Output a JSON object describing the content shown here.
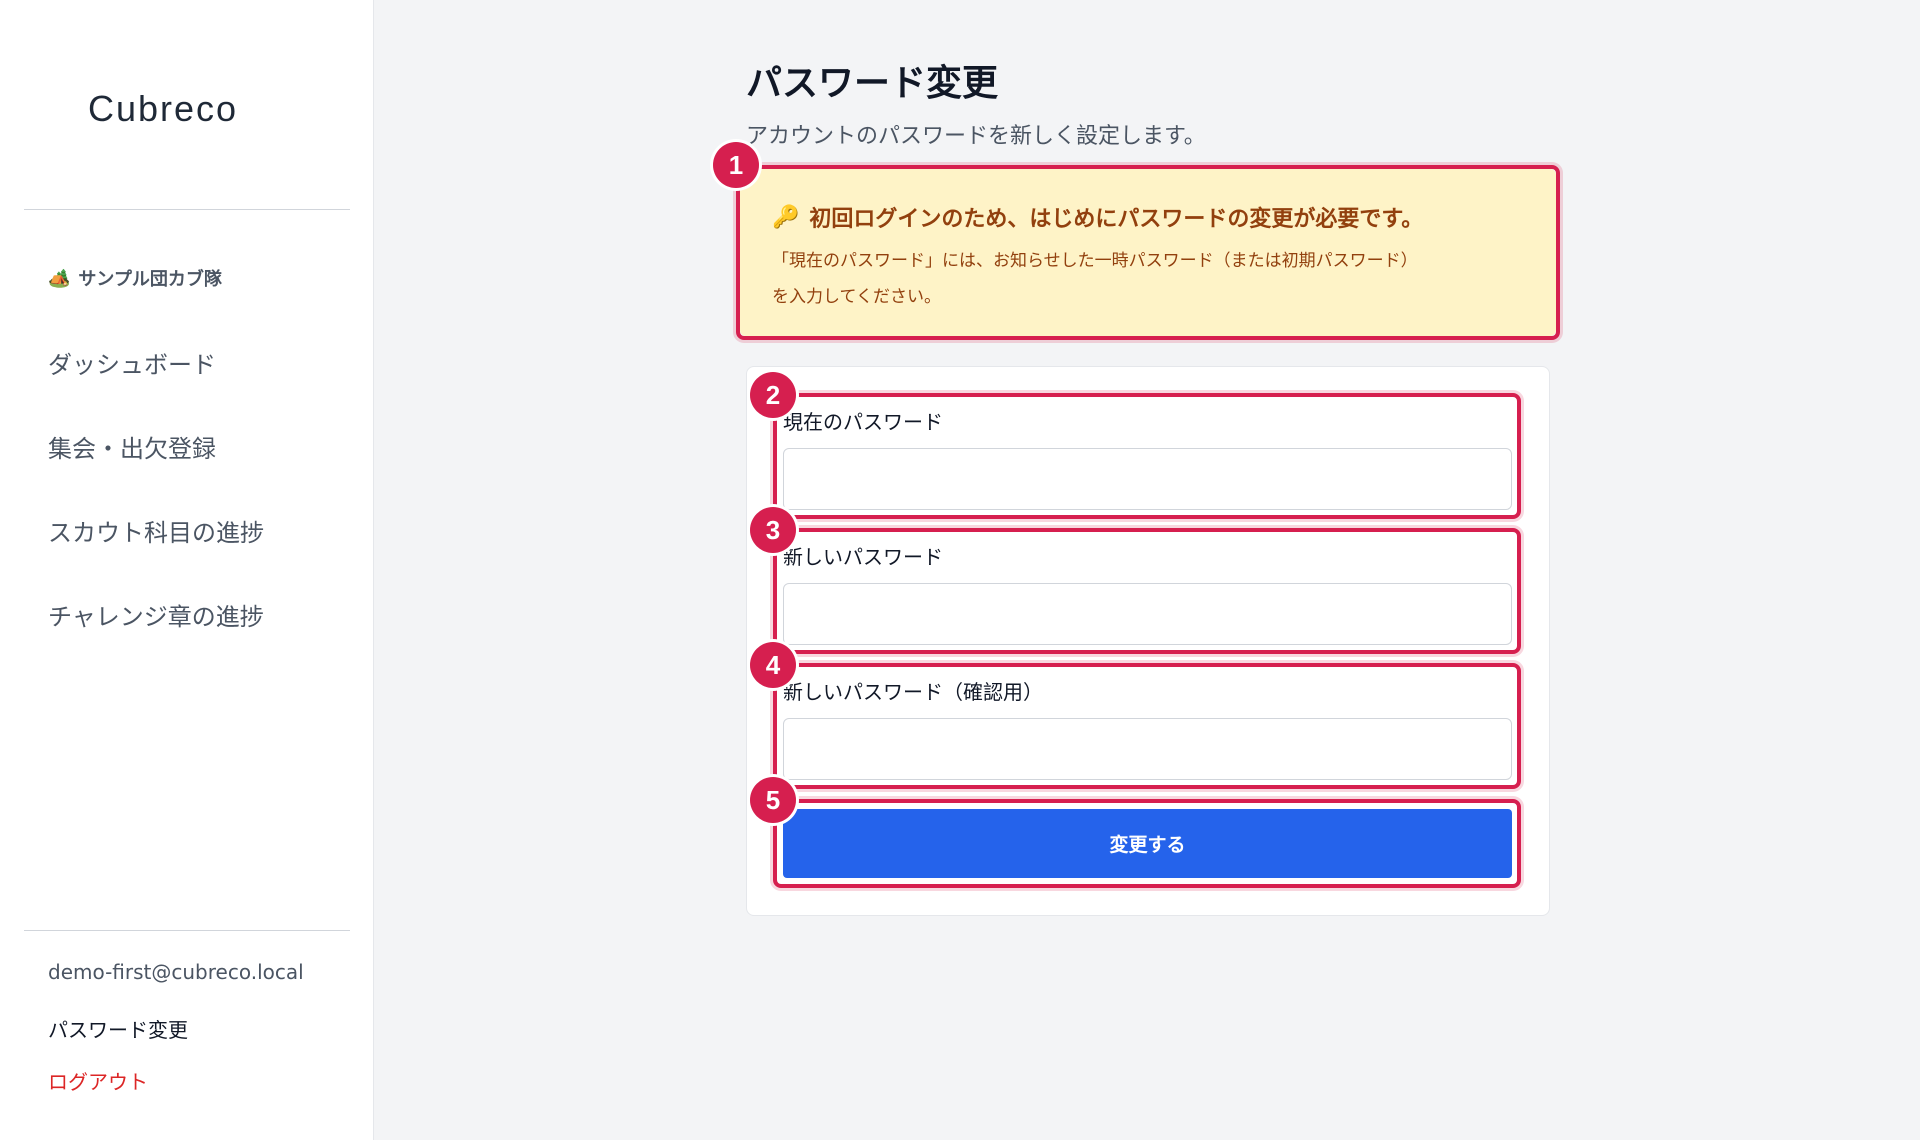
{
  "sidebar": {
    "logo": "Cubreco",
    "group": {
      "icon": "🏕️",
      "name": "サンプル団カブ隊"
    },
    "nav": [
      {
        "label": "ダッシュボード"
      },
      {
        "label": "集会・出欠登録"
      },
      {
        "label": "スカウト科目の進捗"
      },
      {
        "label": "チャレンジ章の進捗"
      }
    ],
    "user_email": "demo-first@cubreco.local",
    "password_link": "パスワード変更",
    "logout_link": "ログアウト"
  },
  "main": {
    "title": "パスワード変更",
    "subtitle": "アカウントのパスワードを新しく設定します。",
    "notice": {
      "icon": "🔑",
      "title": "初回ログインのため、はじめにパスワードの変更が必要です。",
      "body_line1": "「現在のパスワード」には、お知らせした一時パスワード（または初期パスワード）",
      "body_line2": "を入力してください。"
    },
    "form": {
      "current_label": "現在のパスワード",
      "current_value": "",
      "new_label": "新しいパスワード",
      "new_value": "",
      "confirm_label": "新しいパスワード（確認用）",
      "confirm_value": "",
      "submit_label": "変更する"
    }
  },
  "annotations": [
    "1",
    "2",
    "3",
    "4",
    "5"
  ],
  "colors": {
    "accent": "#2563eb",
    "annotation": "#d61f4f",
    "notice_bg": "#fef3c7",
    "notice_text": "#92400e",
    "logout": "#dc2626"
  }
}
